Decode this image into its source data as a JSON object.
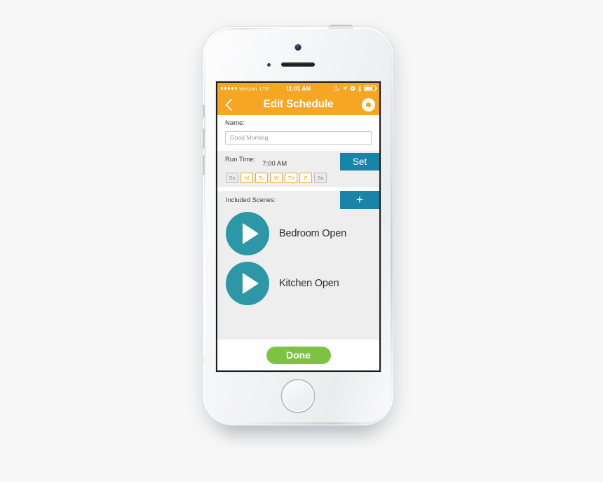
{
  "device": {
    "model_style": "iphone-5s-silver",
    "icons": {
      "front_camera": "front-camera-icon",
      "earpiece": "earpiece-speaker-icon",
      "proximity_sensor": "proximity-sensor-icon",
      "home_button": "home-button"
    }
  },
  "status_bar": {
    "signal_dots_filled": 2,
    "signal_dots_total": 5,
    "carrier": "Verizon",
    "network": "LTE",
    "time": "11:01 AM",
    "icons": [
      "moon-icon",
      "location-arrow-icon",
      "rotation-lock-icon",
      "bluetooth-icon",
      "battery-icon"
    ],
    "battery_level_percent": 80
  },
  "nav_bar": {
    "back_icon": "chevron-left-icon",
    "title": "Edit Schedule",
    "record_icon": "record-button-icon"
  },
  "name_section": {
    "label": "Name:",
    "value": "Good Morning",
    "placeholder": "Good Morning"
  },
  "run_time_section": {
    "label": "Run Time:",
    "time": "7:00 AM",
    "set_label": "Set",
    "days": [
      {
        "label": "Su",
        "active": false
      },
      {
        "label": "M",
        "active": true
      },
      {
        "label": "Tu",
        "active": true
      },
      {
        "label": "W",
        "active": true
      },
      {
        "label": "Th",
        "active": true
      },
      {
        "label": "F",
        "active": true
      },
      {
        "label": "Sa",
        "active": false
      }
    ]
  },
  "scenes_section": {
    "label": "Included Scenes:",
    "add_label": "+",
    "items": [
      {
        "name": "Bedroom Open",
        "icon": "play-icon"
      },
      {
        "name": "Kitchen Open",
        "icon": "play-icon"
      }
    ]
  },
  "footer": {
    "done_label": "Done"
  },
  "colors": {
    "accent_orange": "#f5a623",
    "accent_blue": "#1784a8",
    "accent_teal": "#2e97a7",
    "accent_green": "#7dc242",
    "section_gray": "#eeeeee",
    "page_background": "#f7f7f7"
  }
}
